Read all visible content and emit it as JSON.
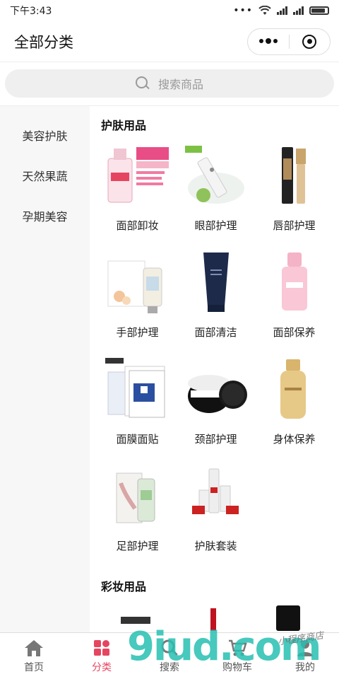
{
  "status_bar": {
    "time": "下午3:43",
    "dots": "•••"
  },
  "nav": {
    "title": "全部分类"
  },
  "search": {
    "placeholder": "搜索商品"
  },
  "sidebar": {
    "items": [
      {
        "label": "美容护肤"
      },
      {
        "label": "天然果蔬"
      },
      {
        "label": "孕期美容"
      }
    ]
  },
  "sections": [
    {
      "title": "护肤用品",
      "items": [
        {
          "label": "面部卸妆",
          "icon": "makeup-remover-bottle-icon"
        },
        {
          "label": "眼部护理",
          "icon": "eye-cream-tube-icon"
        },
        {
          "label": "唇部护理",
          "icon": "lip-care-icon"
        },
        {
          "label": "手部护理",
          "icon": "hand-cream-icon"
        },
        {
          "label": "面部清洁",
          "icon": "facial-cleanser-icon"
        },
        {
          "label": "面部保养",
          "icon": "toner-bottle-icon"
        },
        {
          "label": "面膜面贴",
          "icon": "face-mask-icon"
        },
        {
          "label": "颈部护理",
          "icon": "neck-cream-jar-icon"
        },
        {
          "label": "身体保养",
          "icon": "sunscreen-bottle-icon"
        },
        {
          "label": "足部护理",
          "icon": "foot-cream-icon"
        },
        {
          "label": "护肤套装",
          "icon": "skincare-set-icon"
        }
      ]
    },
    {
      "title": "彩妆用品"
    }
  ],
  "tabs": [
    {
      "label": "首页",
      "icon": "home-icon"
    },
    {
      "label": "分类",
      "icon": "category-icon",
      "active": true
    },
    {
      "label": "搜索",
      "icon": "search-icon"
    },
    {
      "label": "购物车",
      "icon": "cart-icon"
    },
    {
      "label": "我的",
      "icon": "user-icon"
    }
  ],
  "watermark": {
    "logo": "9iud.com",
    "text": "小程序商店"
  },
  "colors": {
    "accent": "#e6455f",
    "sidebar_bg": "#f7f7f7",
    "watermark": "#27c0b2"
  }
}
